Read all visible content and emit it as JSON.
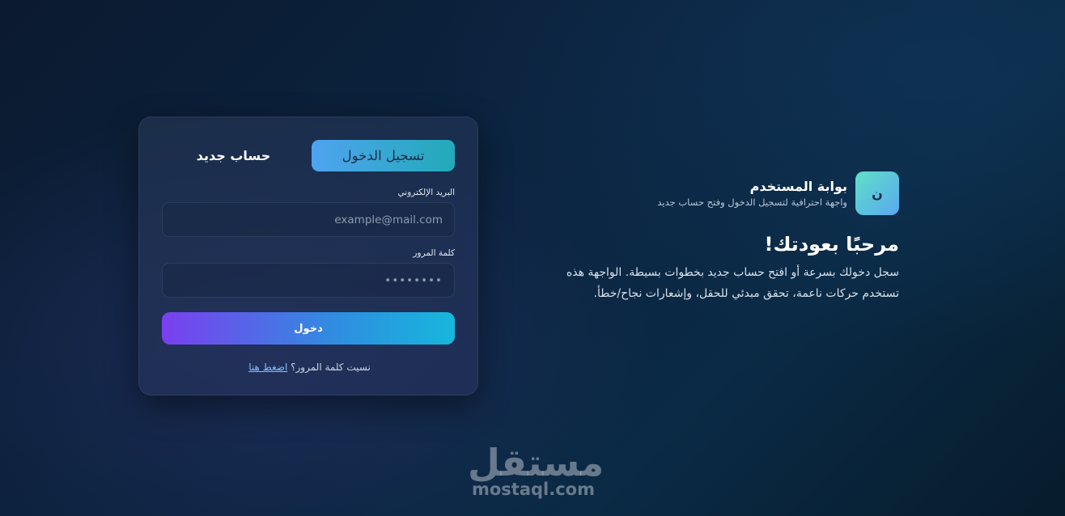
{
  "brand": {
    "logo_letter": "ن",
    "title": "بوابة المستخدم",
    "subtitle": "واجهة احترافية لتسجيل الدخول وفتح حساب جديد"
  },
  "intro": {
    "heading": "مرحبًا بعودتك!",
    "description": "سجل دخولك بسرعة أو افتح حساب جديد بخطوات بسيطة. الواجهة هذه تستخدم حركات ناعمة، تحقق مبدئي للحقل، وإشعارات نجاح/خطأ."
  },
  "tabs": {
    "login": "تسجيل الدخول",
    "register": "حساب جديد",
    "active": "login"
  },
  "form": {
    "email_label": "البريد الإلكتروني",
    "email_placeholder": "example@mail.com",
    "password_label": "كلمة المرور",
    "password_placeholder": "••••••••",
    "submit_label": "دخول",
    "forgot_text": "نسيت كلمة المرور؟",
    "forgot_link": "اضغط هنا"
  },
  "watermark": {
    "arabic": "مستقل",
    "latin": "mostaql.com"
  },
  "colors": {
    "accent_start": "#22aab8",
    "accent_end": "#4fa3f0",
    "button_start": "#16b7dc",
    "button_end": "#7b3ff0",
    "background": "#0b2440"
  }
}
